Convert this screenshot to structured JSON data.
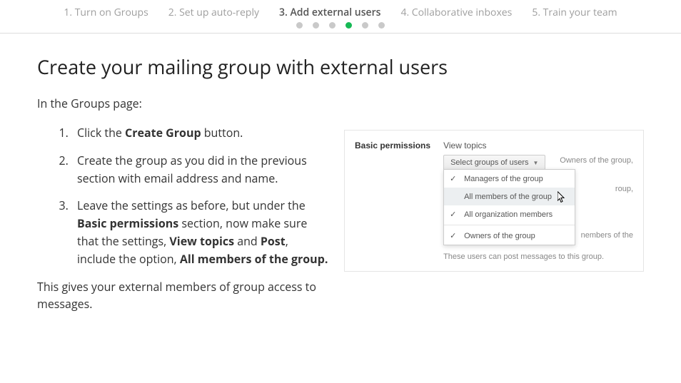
{
  "stepper": {
    "items": [
      {
        "label": "1. Turn on Groups",
        "active": false
      },
      {
        "label": "2. Set up auto-reply",
        "active": false
      },
      {
        "label": "3. Add external users",
        "active": true
      },
      {
        "label": "4. Collaborative inboxes",
        "active": false
      },
      {
        "label": "5. Train your team",
        "active": false
      }
    ]
  },
  "heading": "Create your mailing group with external users",
  "intro": "In the Groups page:",
  "steps": {
    "s1_a": "Click the ",
    "s1_b": "Create Group",
    "s1_c": " button.",
    "s2": "Create the group as you did in the previous section with email address and name.",
    "s3_a": "Leave the settings as before, but under the ",
    "s3_b": "Basic permissions",
    "s3_c": " section, now make sure that the settings, ",
    "s3_d": "View topics",
    "s3_e": " and ",
    "s3_f": "Post",
    "s3_g": ", include the option, ",
    "s3_h": "All members of the group."
  },
  "footnote": "This gives your external members of group access to messages.",
  "figure": {
    "label": "Basic permissions",
    "view_topics": "View topics",
    "select_label": "Select groups of users",
    "owners_text": "Owners of the group,",
    "roup_frag": "roup,",
    "members_frag": "nembers of the",
    "dropdown": {
      "items": [
        {
          "label": "Managers of the group",
          "checked": true,
          "highlight": false
        },
        {
          "label": "All members of the group",
          "checked": false,
          "highlight": true
        },
        {
          "label": "All organization members",
          "checked": true,
          "highlight": false
        }
      ],
      "owner_item": {
        "label": "Owners of the group",
        "checked": true
      }
    },
    "post_note": "These users can post messages to this group."
  }
}
